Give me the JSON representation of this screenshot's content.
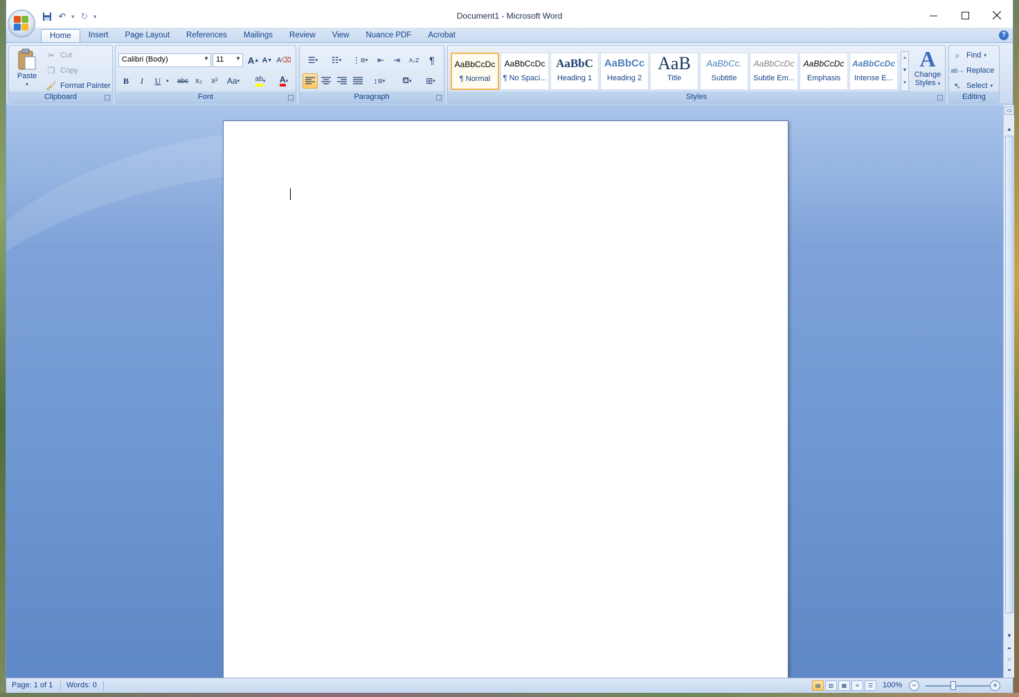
{
  "window": {
    "title": "Document1 - Microsoft Word"
  },
  "qat": {
    "save": "save-icon",
    "undo": "undo-icon",
    "redo": "redo-icon",
    "customize": "▾"
  },
  "tabs": [
    "Home",
    "Insert",
    "Page Layout",
    "References",
    "Mailings",
    "Review",
    "View",
    "Nuance PDF",
    "Acrobat"
  ],
  "ribbon": {
    "clipboard": {
      "label": "Clipboard",
      "paste": "Paste",
      "cut": "Cut",
      "copy": "Copy",
      "format_painter": "Format Painter"
    },
    "font": {
      "label": "Font",
      "font_name": "Calibri (Body)",
      "font_size": "11",
      "bold": "B",
      "italic": "I",
      "underline": "U",
      "strike": "abc",
      "subscript": "x₂",
      "superscript": "x²",
      "change_case": "Aa",
      "grow": "A",
      "shrink": "A",
      "highlight": "ab",
      "font_color": "A"
    },
    "paragraph": {
      "label": "Paragraph",
      "sort": "A↓Z",
      "pilcrow": "¶"
    },
    "styles": {
      "label": "Styles",
      "items": [
        {
          "sample": "AaBbCcDc",
          "name": "¶ Normal"
        },
        {
          "sample": "AaBbCcDc",
          "name": "¶ No Spaci..."
        },
        {
          "sample": "AaBbC",
          "name": "Heading 1"
        },
        {
          "sample": "AaBbCc",
          "name": "Heading 2"
        },
        {
          "sample": "AaB",
          "name": "Title"
        },
        {
          "sample": "AaBbCc.",
          "name": "Subtitle"
        },
        {
          "sample": "AaBbCcDc",
          "name": "Subtle Em..."
        },
        {
          "sample": "AaBbCcDc",
          "name": "Emphasis"
        },
        {
          "sample": "AaBbCcDc",
          "name": "Intense E..."
        }
      ],
      "change_styles_line1": "Change",
      "change_styles_line2": "Styles"
    },
    "editing": {
      "label": "Editing",
      "find": "Find",
      "replace": "Replace",
      "select": "Select"
    }
  },
  "status": {
    "page": "Page: 1 of 1",
    "words": "Words: 0",
    "zoom": "100%"
  },
  "colors": {
    "ribbon_text": "#15428b",
    "active_style_border": "#f3b54c",
    "highlight_yellow": "#ffff00",
    "font_color_red": "#e31b1b"
  }
}
